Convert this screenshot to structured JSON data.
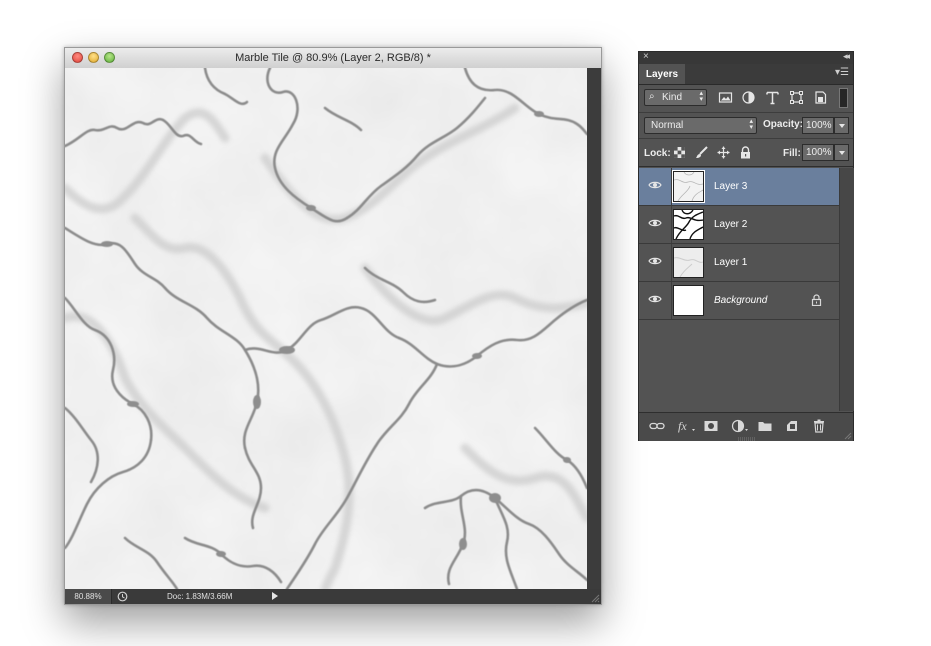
{
  "document": {
    "title": "Marble Tile @ 80.9% (Layer 2, RGB/8) *",
    "zoom": "80.88%",
    "doc_size": "Doc: 1.83M/3.66M"
  },
  "layers_panel": {
    "tab": "Layers",
    "filter": {
      "kind_label": "Kind"
    },
    "blend_mode": "Normal",
    "opacity_label": "Opacity:",
    "opacity_value": "100%",
    "lock_label": "Lock:",
    "fill_label": "Fill:",
    "fill_value": "100%",
    "layers": [
      {
        "name": "Layer 3",
        "active": true,
        "thumb": "marble-light"
      },
      {
        "name": "Layer 2",
        "active": false,
        "thumb": "marble-dark"
      },
      {
        "name": "Layer 1",
        "active": false,
        "thumb": "marble-light"
      },
      {
        "name": "Background",
        "active": false,
        "thumb": "white",
        "locked": true
      }
    ],
    "footer_icons": [
      "link-icon",
      "fx-icon",
      "mask-icon",
      "adjustment-icon",
      "folder-icon",
      "new-layer-icon",
      "trash-icon"
    ]
  },
  "colors": {
    "panel_bg": "#535353",
    "active_layer": "#6a7f9d",
    "marble_vein": "#8a8a8a",
    "marble_base": "#f3f3f3"
  }
}
